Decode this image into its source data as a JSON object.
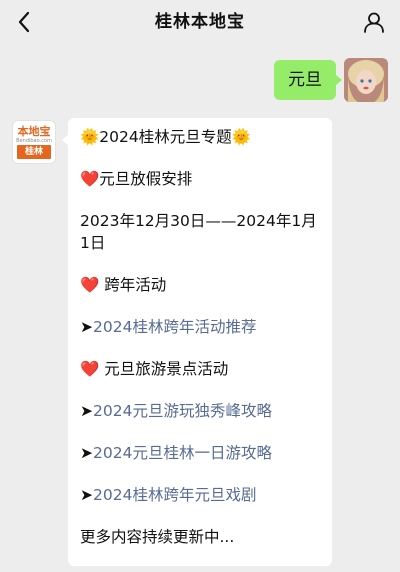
{
  "header": {
    "title": "桂林本地宝",
    "back_icon": "chevron-left-icon",
    "profile_icon": "person-icon"
  },
  "outgoing": {
    "text": "元旦"
  },
  "bot": {
    "logo_name": "本地宝",
    "logo_site": "Bendibao.com",
    "logo_city": "桂林"
  },
  "message": {
    "title": "🌞2024桂林元旦专题🌞",
    "holiday_heading": "❤️元旦放假安排",
    "holiday_dates": "2023年12月30日——2024年1月1日",
    "newyear_heading": "❤️ 跨年活动",
    "link_newyear": "2024桂林跨年活动推荐",
    "scenic_heading": "❤️ 元旦旅游景点活动",
    "link_duxiufeng": "2024元旦游玩独秀峰攻略",
    "link_oneday": "2024元旦桂林一日游攻略",
    "link_drama": "2024桂林跨年元旦戏剧",
    "footer": "更多内容持续更新中..."
  },
  "colors": {
    "background": "#ededed",
    "outgoing_bubble": "#95ec69",
    "incoming_bubble": "#ffffff",
    "link": "#576b95",
    "brand": "#e5661f"
  }
}
